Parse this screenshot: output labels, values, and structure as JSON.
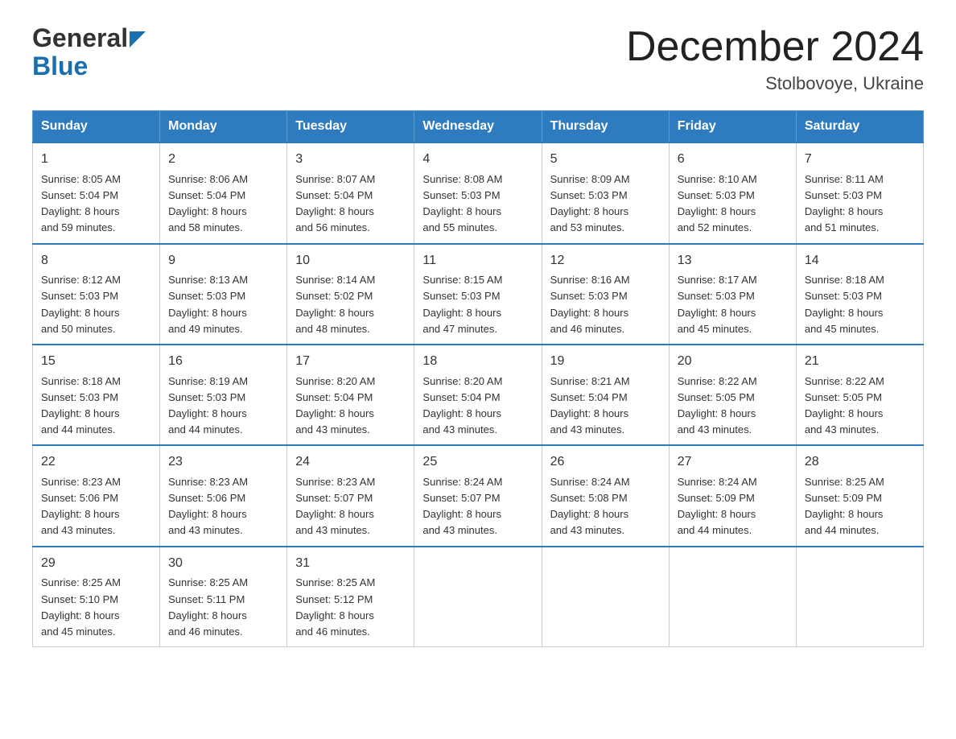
{
  "header": {
    "logo_general": "General",
    "logo_blue": "Blue",
    "title": "December 2024",
    "location": "Stolbovoye, Ukraine"
  },
  "days_of_week": [
    "Sunday",
    "Monday",
    "Tuesday",
    "Wednesday",
    "Thursday",
    "Friday",
    "Saturday"
  ],
  "weeks": [
    [
      {
        "day": "1",
        "sunrise": "8:05 AM",
        "sunset": "5:04 PM",
        "daylight_hours": "8 hours",
        "daylight_minutes": "and 59 minutes."
      },
      {
        "day": "2",
        "sunrise": "8:06 AM",
        "sunset": "5:04 PM",
        "daylight_hours": "8 hours",
        "daylight_minutes": "and 58 minutes."
      },
      {
        "day": "3",
        "sunrise": "8:07 AM",
        "sunset": "5:04 PM",
        "daylight_hours": "8 hours",
        "daylight_minutes": "and 56 minutes."
      },
      {
        "day": "4",
        "sunrise": "8:08 AM",
        "sunset": "5:03 PM",
        "daylight_hours": "8 hours",
        "daylight_minutes": "and 55 minutes."
      },
      {
        "day": "5",
        "sunrise": "8:09 AM",
        "sunset": "5:03 PM",
        "daylight_hours": "8 hours",
        "daylight_minutes": "and 53 minutes."
      },
      {
        "day": "6",
        "sunrise": "8:10 AM",
        "sunset": "5:03 PM",
        "daylight_hours": "8 hours",
        "daylight_minutes": "and 52 minutes."
      },
      {
        "day": "7",
        "sunrise": "8:11 AM",
        "sunset": "5:03 PM",
        "daylight_hours": "8 hours",
        "daylight_minutes": "and 51 minutes."
      }
    ],
    [
      {
        "day": "8",
        "sunrise": "8:12 AM",
        "sunset": "5:03 PM",
        "daylight_hours": "8 hours",
        "daylight_minutes": "and 50 minutes."
      },
      {
        "day": "9",
        "sunrise": "8:13 AM",
        "sunset": "5:03 PM",
        "daylight_hours": "8 hours",
        "daylight_minutes": "and 49 minutes."
      },
      {
        "day": "10",
        "sunrise": "8:14 AM",
        "sunset": "5:02 PM",
        "daylight_hours": "8 hours",
        "daylight_minutes": "and 48 minutes."
      },
      {
        "day": "11",
        "sunrise": "8:15 AM",
        "sunset": "5:03 PM",
        "daylight_hours": "8 hours",
        "daylight_minutes": "and 47 minutes."
      },
      {
        "day": "12",
        "sunrise": "8:16 AM",
        "sunset": "5:03 PM",
        "daylight_hours": "8 hours",
        "daylight_minutes": "and 46 minutes."
      },
      {
        "day": "13",
        "sunrise": "8:17 AM",
        "sunset": "5:03 PM",
        "daylight_hours": "8 hours",
        "daylight_minutes": "and 45 minutes."
      },
      {
        "day": "14",
        "sunrise": "8:18 AM",
        "sunset": "5:03 PM",
        "daylight_hours": "8 hours",
        "daylight_minutes": "and 45 minutes."
      }
    ],
    [
      {
        "day": "15",
        "sunrise": "8:18 AM",
        "sunset": "5:03 PM",
        "daylight_hours": "8 hours",
        "daylight_minutes": "and 44 minutes."
      },
      {
        "day": "16",
        "sunrise": "8:19 AM",
        "sunset": "5:03 PM",
        "daylight_hours": "8 hours",
        "daylight_minutes": "and 44 minutes."
      },
      {
        "day": "17",
        "sunrise": "8:20 AM",
        "sunset": "5:04 PM",
        "daylight_hours": "8 hours",
        "daylight_minutes": "and 43 minutes."
      },
      {
        "day": "18",
        "sunrise": "8:20 AM",
        "sunset": "5:04 PM",
        "daylight_hours": "8 hours",
        "daylight_minutes": "and 43 minutes."
      },
      {
        "day": "19",
        "sunrise": "8:21 AM",
        "sunset": "5:04 PM",
        "daylight_hours": "8 hours",
        "daylight_minutes": "and 43 minutes."
      },
      {
        "day": "20",
        "sunrise": "8:22 AM",
        "sunset": "5:05 PM",
        "daylight_hours": "8 hours",
        "daylight_minutes": "and 43 minutes."
      },
      {
        "day": "21",
        "sunrise": "8:22 AM",
        "sunset": "5:05 PM",
        "daylight_hours": "8 hours",
        "daylight_minutes": "and 43 minutes."
      }
    ],
    [
      {
        "day": "22",
        "sunrise": "8:23 AM",
        "sunset": "5:06 PM",
        "daylight_hours": "8 hours",
        "daylight_minutes": "and 43 minutes."
      },
      {
        "day": "23",
        "sunrise": "8:23 AM",
        "sunset": "5:06 PM",
        "daylight_hours": "8 hours",
        "daylight_minutes": "and 43 minutes."
      },
      {
        "day": "24",
        "sunrise": "8:23 AM",
        "sunset": "5:07 PM",
        "daylight_hours": "8 hours",
        "daylight_minutes": "and 43 minutes."
      },
      {
        "day": "25",
        "sunrise": "8:24 AM",
        "sunset": "5:07 PM",
        "daylight_hours": "8 hours",
        "daylight_minutes": "and 43 minutes."
      },
      {
        "day": "26",
        "sunrise": "8:24 AM",
        "sunset": "5:08 PM",
        "daylight_hours": "8 hours",
        "daylight_minutes": "and 43 minutes."
      },
      {
        "day": "27",
        "sunrise": "8:24 AM",
        "sunset": "5:09 PM",
        "daylight_hours": "8 hours",
        "daylight_minutes": "and 44 minutes."
      },
      {
        "day": "28",
        "sunrise": "8:25 AM",
        "sunset": "5:09 PM",
        "daylight_hours": "8 hours",
        "daylight_minutes": "and 44 minutes."
      }
    ],
    [
      {
        "day": "29",
        "sunrise": "8:25 AM",
        "sunset": "5:10 PM",
        "daylight_hours": "8 hours",
        "daylight_minutes": "and 45 minutes."
      },
      {
        "day": "30",
        "sunrise": "8:25 AM",
        "sunset": "5:11 PM",
        "daylight_hours": "8 hours",
        "daylight_minutes": "and 46 minutes."
      },
      {
        "day": "31",
        "sunrise": "8:25 AM",
        "sunset": "5:12 PM",
        "daylight_hours": "8 hours",
        "daylight_minutes": "and 46 minutes."
      },
      null,
      null,
      null,
      null
    ]
  ]
}
